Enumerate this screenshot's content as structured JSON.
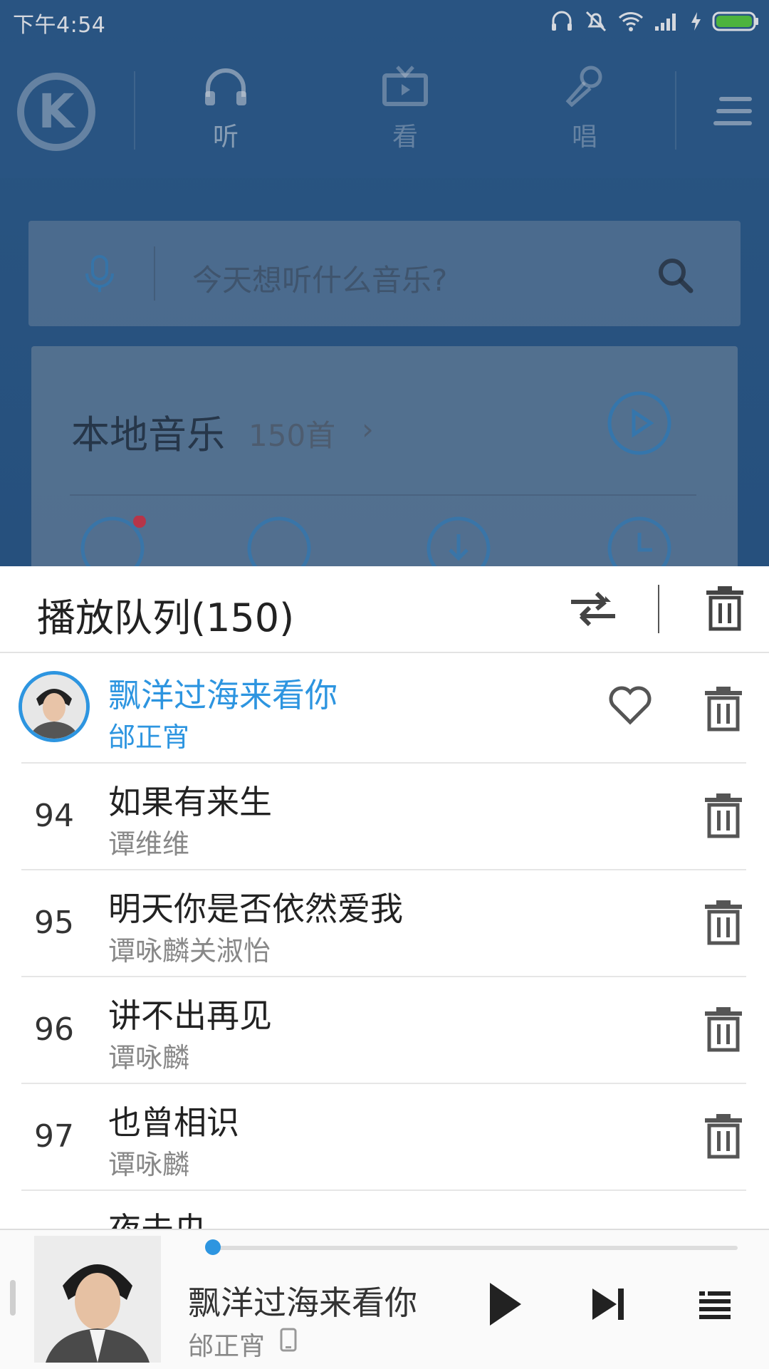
{
  "status_bar": {
    "time": "下午4:54"
  },
  "nav": {
    "tabs": [
      {
        "label": "听",
        "active": true
      },
      {
        "label": "看",
        "active": false
      },
      {
        "label": "唱",
        "active": false
      }
    ]
  },
  "search": {
    "placeholder": "今天想听什么音乐?"
  },
  "local_music": {
    "title": "本地音乐",
    "count": "150首"
  },
  "queue": {
    "title": "播放队列(150)",
    "items": [
      {
        "num": "",
        "title": "飘洋过海来看你",
        "artist": "邰正宵",
        "current": true
      },
      {
        "num": "94",
        "title": "如果有来生",
        "artist": "谭维维"
      },
      {
        "num": "95",
        "title": "明天你是否依然爱我",
        "artist": "谭咏麟关淑怡"
      },
      {
        "num": "96",
        "title": "讲不出再见",
        "artist": "谭咏麟"
      },
      {
        "num": "97",
        "title": "也曾相识",
        "artist": "谭咏麟"
      },
      {
        "num": "",
        "title": "夜未央",
        "artist": ""
      }
    ]
  },
  "player": {
    "title": "飘洋过海来看你",
    "artist": "邰正宵",
    "progress": 0.01
  },
  "colors": {
    "accent": "#2d95e0",
    "header_bg": "#2e5f8f"
  },
  "icons": [
    "kugou-logo",
    "headphones-icon",
    "tv-icon",
    "microphone-icon",
    "menu-icon",
    "voice-search-icon",
    "search-icon",
    "play-circle-icon",
    "shuffle-icon",
    "trash-icon",
    "heart-icon",
    "play-icon",
    "next-icon",
    "playlist-icon",
    "device-icon"
  ]
}
